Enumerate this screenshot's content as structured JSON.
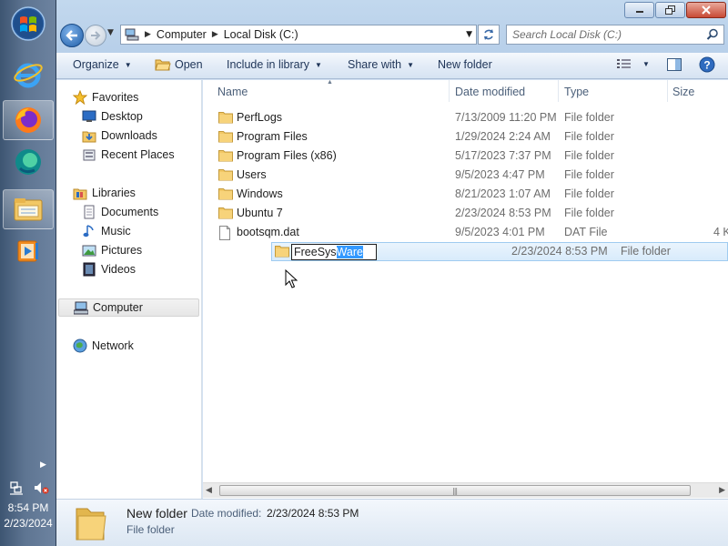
{
  "taskbar": {
    "items": [
      {
        "name": "start-orb"
      },
      {
        "name": "internet-explorer-icon"
      },
      {
        "name": "firefox-icon"
      },
      {
        "name": "edge-icon"
      },
      {
        "name": "windows-explorer-icon"
      },
      {
        "name": "media-player-icon"
      }
    ],
    "clock_time": "8:54 PM",
    "clock_date": "2/23/2024"
  },
  "address": {
    "crumbs": [
      "Computer",
      "Local Disk (C:)"
    ]
  },
  "search": {
    "placeholder": "Search Local Disk (C:)"
  },
  "toolbar": {
    "organize": "Organize",
    "open": "Open",
    "include": "Include in library",
    "share": "Share with",
    "new_folder": "New folder"
  },
  "nav": {
    "favorites": "Favorites",
    "desktop": "Desktop",
    "downloads": "Downloads",
    "recent": "Recent Places",
    "libraries": "Libraries",
    "documents": "Documents",
    "music": "Music",
    "pictures": "Pictures",
    "videos": "Videos",
    "computer": "Computer",
    "network": "Network"
  },
  "columns": {
    "name": "Name",
    "date": "Date modified",
    "type": "Type",
    "size": "Size"
  },
  "files": [
    {
      "name": "PerfLogs",
      "date": "7/13/2009 11:20 PM",
      "type": "File folder",
      "size": "",
      "kind": "folder"
    },
    {
      "name": "Program Files",
      "date": "1/29/2024 2:24 AM",
      "type": "File folder",
      "size": "",
      "kind": "folder"
    },
    {
      "name": "Program Files (x86)",
      "date": "5/17/2023 7:37 PM",
      "type": "File folder",
      "size": "",
      "kind": "folder"
    },
    {
      "name": "Users",
      "date": "9/5/2023 4:47 PM",
      "type": "File folder",
      "size": "",
      "kind": "folder"
    },
    {
      "name": "Windows",
      "date": "8/21/2023 1:07 AM",
      "type": "File folder",
      "size": "",
      "kind": "folder"
    },
    {
      "name": "Ubuntu 7",
      "date": "2/23/2024 8:53 PM",
      "type": "File folder",
      "size": "",
      "kind": "folder"
    },
    {
      "name": "bootsqm.dat",
      "date": "9/5/2023 4:01 PM",
      "type": "DAT File",
      "size": "4 K",
      "kind": "file"
    },
    {
      "name": "FreeSysWare",
      "date": "2/23/2024 8:53 PM",
      "type": "File folder",
      "size": "",
      "kind": "folder"
    }
  ],
  "rename": {
    "unselected": "FreeSys",
    "selected": "Ware"
  },
  "details": {
    "name": "New folder",
    "date_label": "Date modified:",
    "date": "2/23/2024 8:53 PM",
    "type": "File folder"
  },
  "colors": {
    "selection": "#3399ff",
    "row_selected_border": "#9fcbf0",
    "toolbar_text": "#1e3457"
  }
}
